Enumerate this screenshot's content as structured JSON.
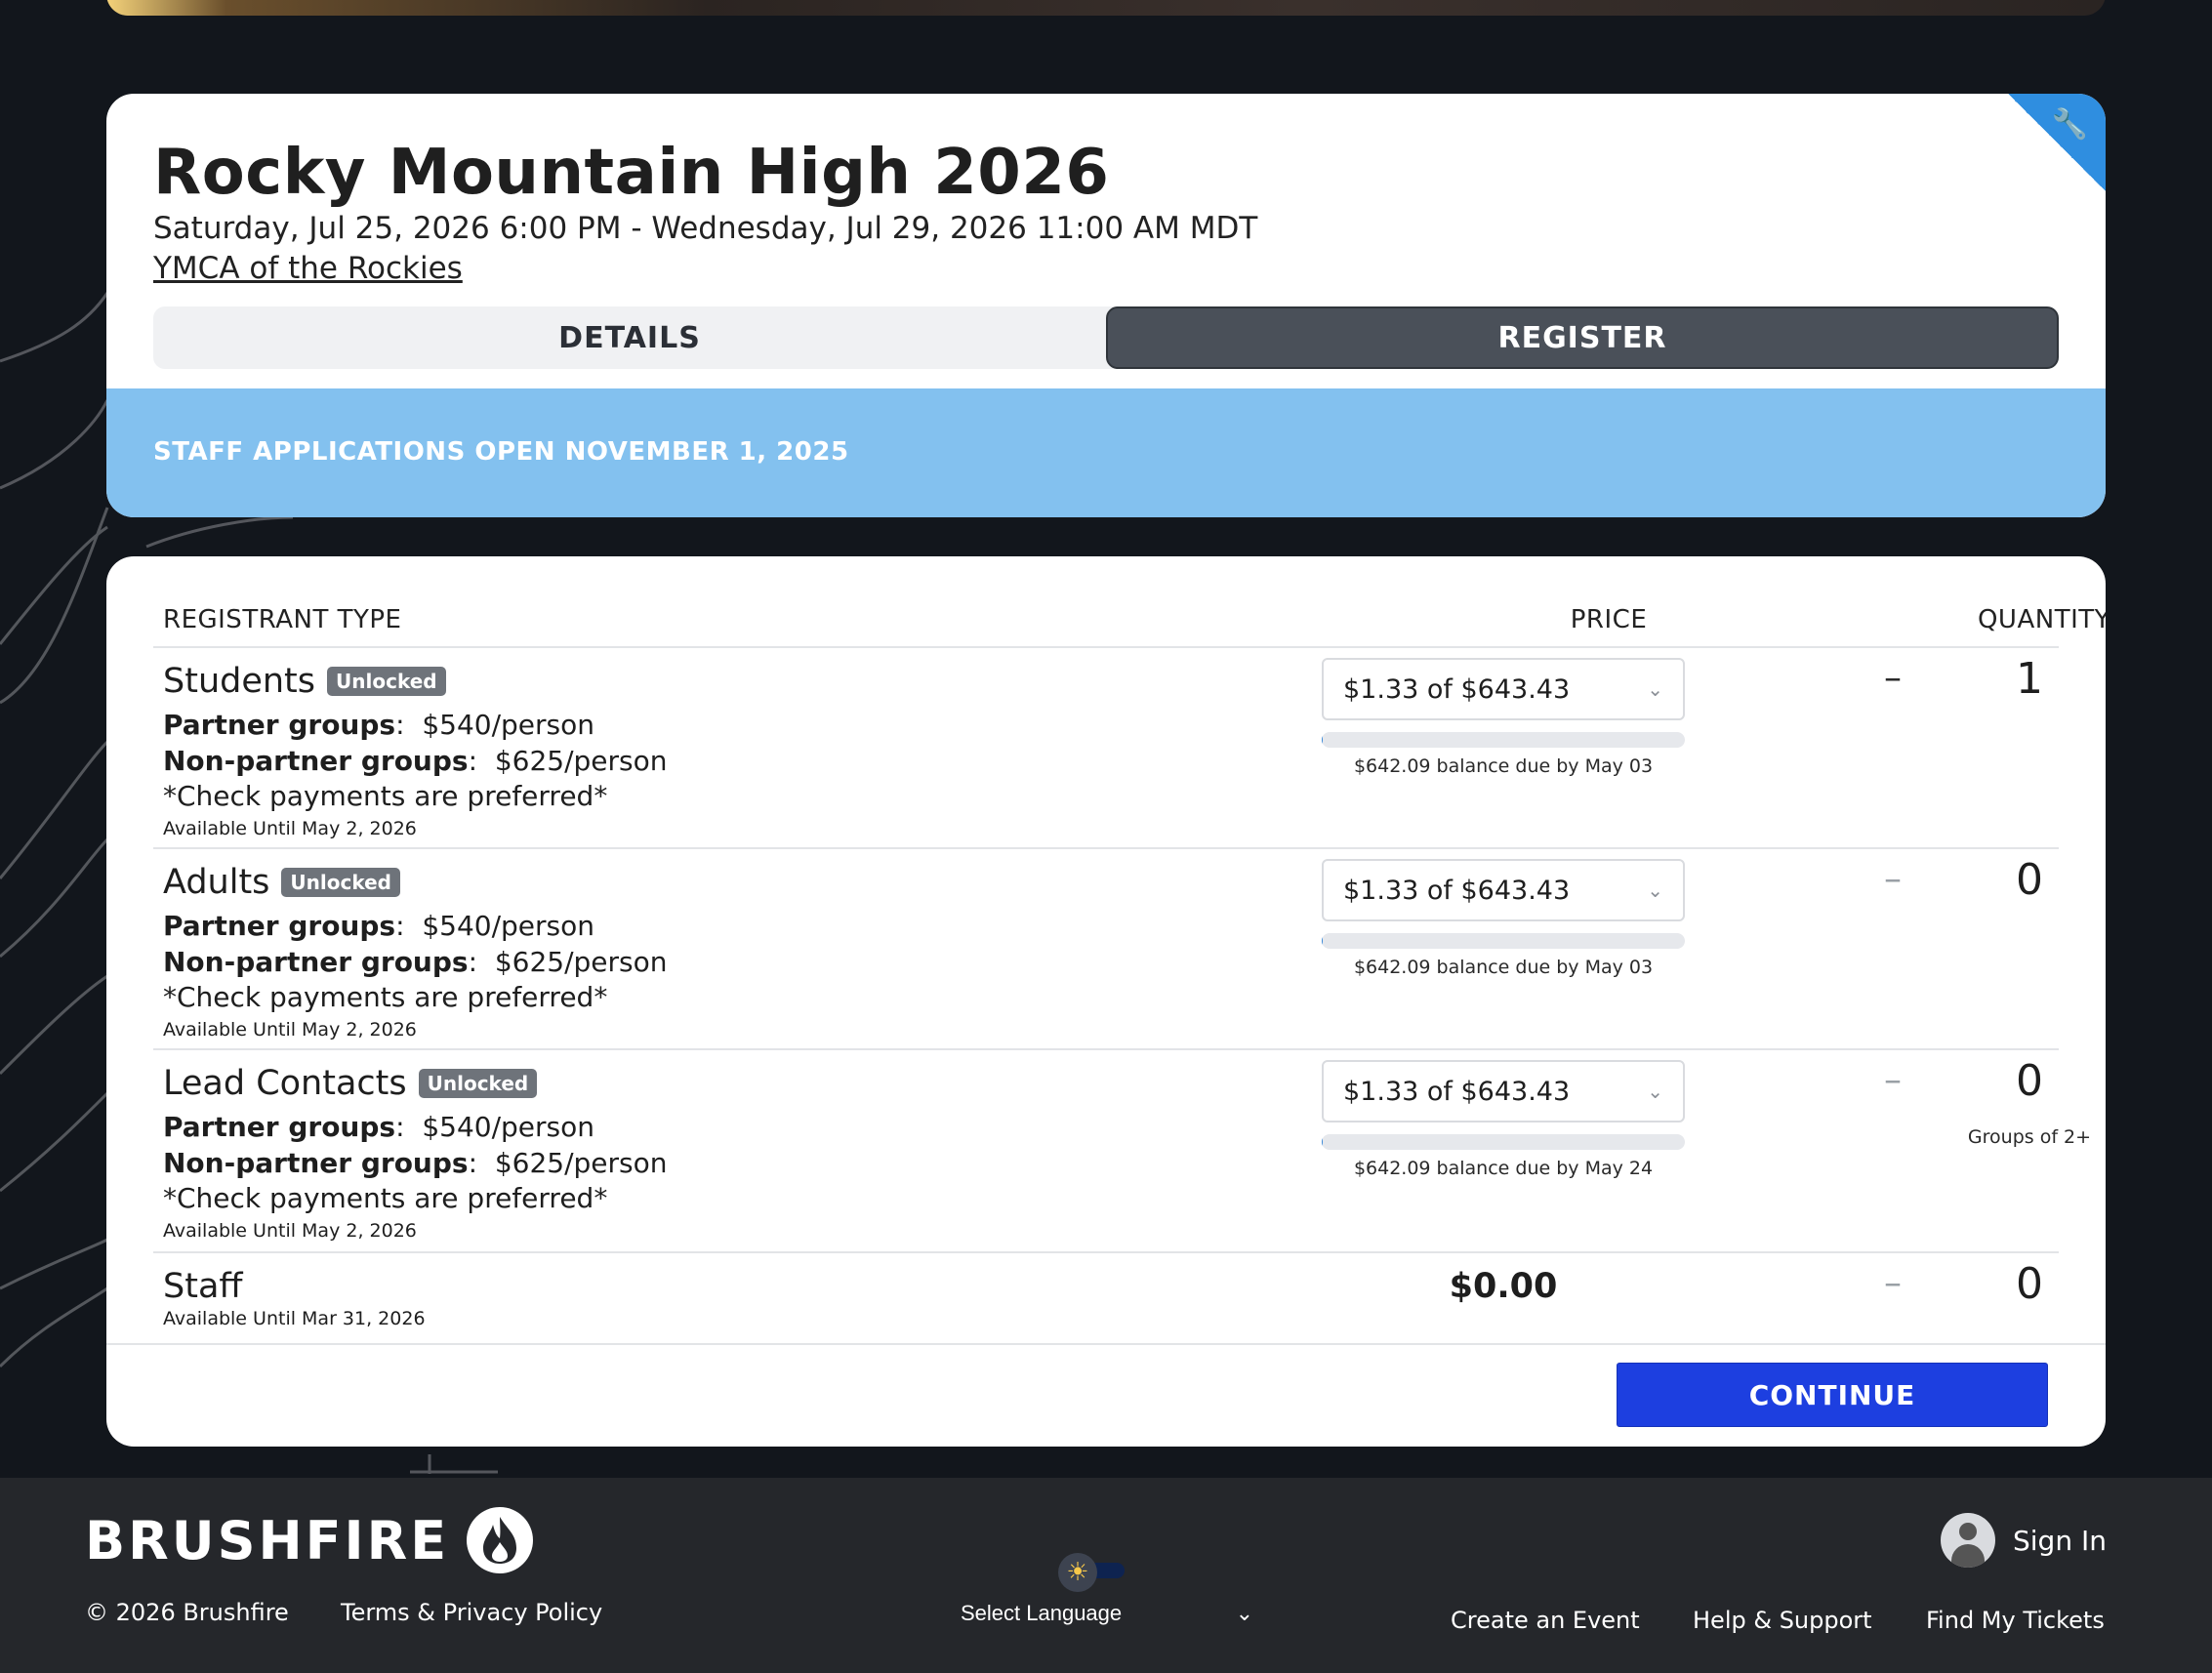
{
  "event": {
    "title": "Rocky Mountain High 2026",
    "dates": "Saturday, Jul 25, 2026 6:00 PM - Wednesday, Jul 29, 2026 11:00 AM MDT",
    "venue": "YMCA of the Rockies",
    "admin_icon": "wrench-icon"
  },
  "tabs": [
    {
      "label": "DETAILS",
      "active": false
    },
    {
      "label": "REGISTER",
      "active": true
    }
  ],
  "banner": {
    "text": "STAFF APPLICATIONS OPEN NOVEMBER 1, 2025",
    "color": "#83c1ef"
  },
  "table": {
    "headers": {
      "type": "REGISTRANT TYPE",
      "price": "PRICE",
      "quantity": "QUANTITY"
    },
    "rows": [
      {
        "name": "Students",
        "badge": "Unlocked",
        "partner_label": "Partner groups",
        "partner_price": "$540/person",
        "nonpartner_label": "Non-partner groups",
        "nonpartner_price": "$625/person",
        "note": "*Check payments are preferred*",
        "available": "Available Until May 2, 2026",
        "price_select": "$1.33 of $643.43",
        "balance": "$642.09 balance due by May 03",
        "deposit_fraction": 0.002,
        "quantity": "1"
      },
      {
        "name": "Adults",
        "badge": "Unlocked",
        "partner_label": "Partner groups",
        "partner_price": "$540/person",
        "nonpartner_label": "Non-partner groups",
        "nonpartner_price": "$625/person",
        "note": "*Check payments are preferred*",
        "available": "Available Until May 2, 2026",
        "price_select": "$1.33 of $643.43",
        "balance": "$642.09 balance due by May 03",
        "deposit_fraction": 0.002,
        "quantity": "0"
      },
      {
        "name": "Lead Contacts",
        "badge": "Unlocked",
        "partner_label": "Partner groups",
        "partner_price": "$540/person",
        "nonpartner_label": "Non-partner groups",
        "nonpartner_price": "$625/person",
        "note": "*Check payments are preferred*",
        "available": "Available Until May 2, 2026",
        "price_select": "$1.33 of $643.43",
        "balance": "$642.09 balance due by May 24",
        "deposit_fraction": 0.002,
        "quantity": "0",
        "quantity_note": "Groups of 2+"
      },
      {
        "name": "Staff",
        "available": "Available Until Mar 31, 2026",
        "price": "$0.00",
        "quantity": "0"
      }
    ],
    "minus_symbol": "–",
    "plus_symbol": "+"
  },
  "continue_label": "CONTINUE",
  "accent": "#1d3fe0",
  "footer": {
    "brand": "BRUSHFIRE",
    "copyright": "© 2026 Brushfire",
    "terms": "Terms & Privacy Policy",
    "language": "Select Language",
    "sign_in": "Sign In",
    "links": [
      "Create an Event",
      "Help & Support",
      "Find My Tickets"
    ]
  }
}
